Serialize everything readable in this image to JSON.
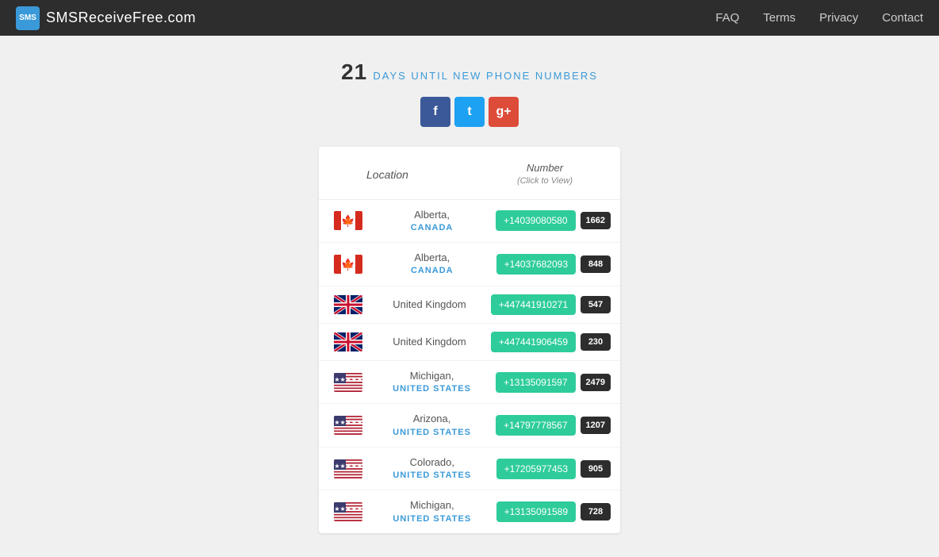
{
  "header": {
    "logo_icon": "SMS",
    "logo_text": "SMSReceiveFree",
    "logo_suffix": ".com",
    "nav": [
      {
        "label": "FAQ",
        "href": "#"
      },
      {
        "label": "Terms",
        "href": "#"
      },
      {
        "label": "Privacy",
        "href": "#"
      },
      {
        "label": "Contact",
        "href": "#"
      }
    ]
  },
  "countdown": {
    "number": "21",
    "text": "DAYS UNTIL NEW PHONE NUMBERS"
  },
  "social": [
    {
      "label": "f",
      "type": "facebook"
    },
    {
      "label": "t",
      "type": "twitter"
    },
    {
      "label": "g+",
      "type": "googleplus"
    }
  ],
  "table": {
    "col_location": "Location",
    "col_number": "Number",
    "col_number_sub": "(Click to View)",
    "rows": [
      {
        "flag": "ca",
        "city": "Alberta,",
        "country": "CANADA",
        "number": "+14039080580",
        "count": "1662"
      },
      {
        "flag": "ca",
        "city": "Alberta,",
        "country": "CANADA",
        "number": "+14037682093",
        "count": "848"
      },
      {
        "flag": "uk",
        "city": "United Kingdom",
        "country": "",
        "number": "+447441910271",
        "count": "547"
      },
      {
        "flag": "uk",
        "city": "United Kingdom",
        "country": "",
        "number": "+447441906459",
        "count": "230"
      },
      {
        "flag": "us",
        "city": "Michigan,",
        "country": "UNITED STATES",
        "number": "+13135091597",
        "count": "2479"
      },
      {
        "flag": "us",
        "city": "Arizona,",
        "country": "UNITED STATES",
        "number": "+14797778567",
        "count": "1207"
      },
      {
        "flag": "us",
        "city": "Colorado,",
        "country": "UNITED STATES",
        "number": "+17205977453",
        "count": "905"
      },
      {
        "flag": "us",
        "city": "Michigan,",
        "country": "UNITED STATES",
        "number": "+13135091589",
        "count": "728"
      }
    ]
  }
}
